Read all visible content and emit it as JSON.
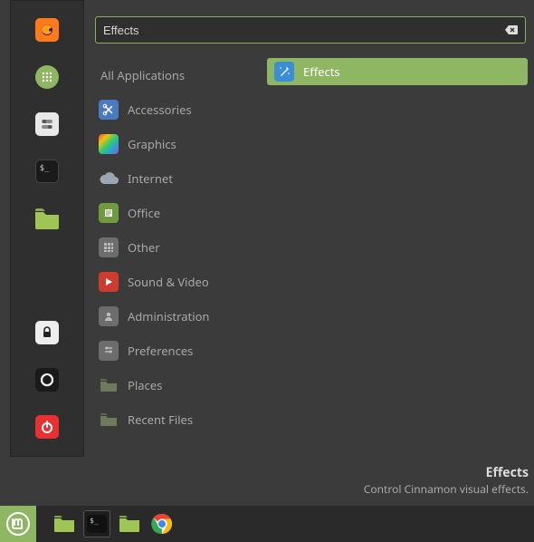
{
  "search": {
    "value": "Effects"
  },
  "categories": {
    "all": "All Applications",
    "items": [
      {
        "label": "Accessories"
      },
      {
        "label": "Graphics"
      },
      {
        "label": "Internet"
      },
      {
        "label": "Office"
      },
      {
        "label": "Other"
      },
      {
        "label": "Sound & Video"
      },
      {
        "label": "Administration"
      },
      {
        "label": "Preferences"
      },
      {
        "label": "Places"
      },
      {
        "label": "Recent Files"
      }
    ]
  },
  "apps": {
    "selected": {
      "label": "Effects"
    }
  },
  "tooltip": {
    "title": "Effects",
    "desc": "Control Cinnamon visual effects."
  }
}
